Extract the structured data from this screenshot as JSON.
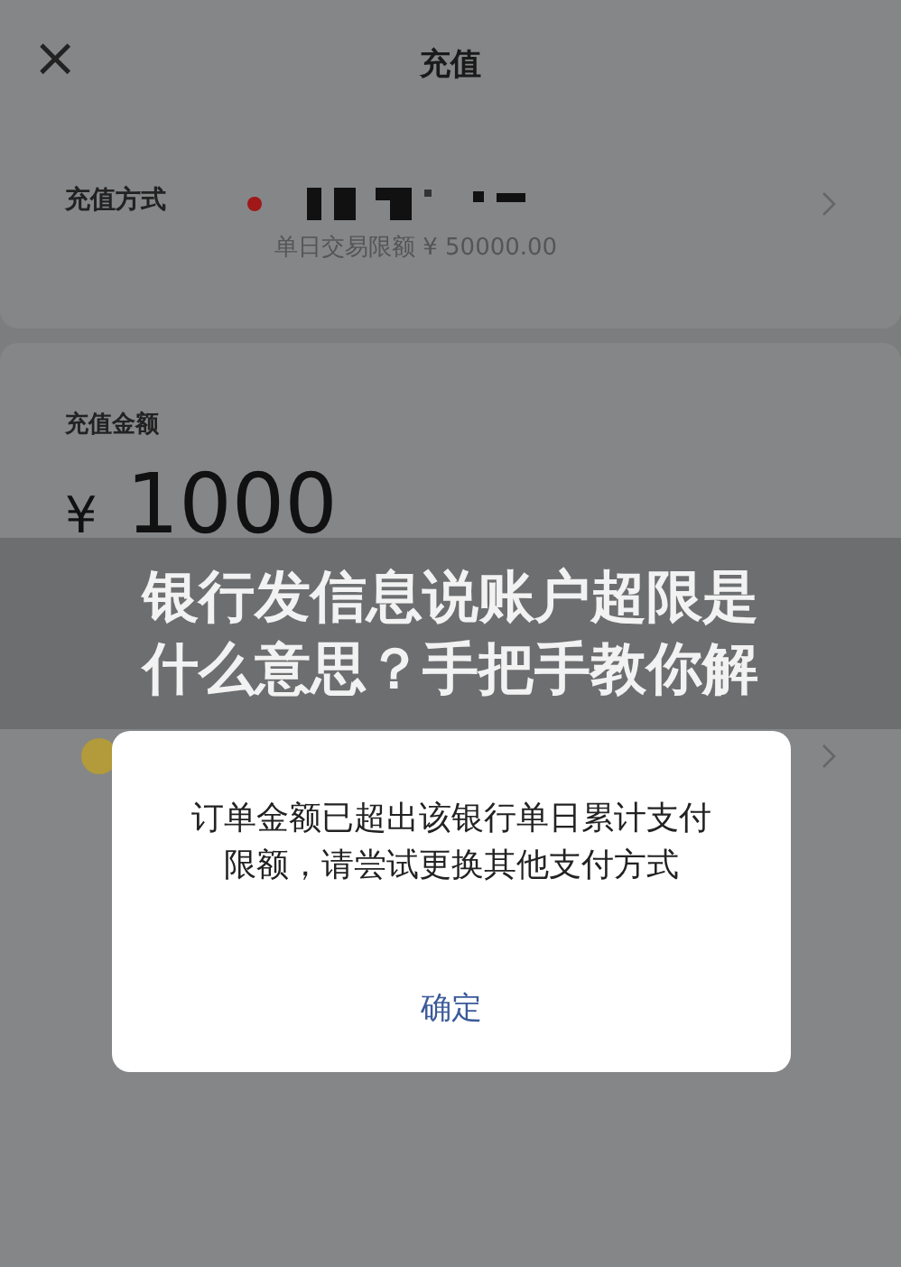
{
  "header": {
    "close_icon": "×",
    "title": "充值"
  },
  "payment_method": {
    "label": "充值方式",
    "limit": "单日交易限额 ¥ 50000.00"
  },
  "amount": {
    "label": "充值金额",
    "currency": "¥",
    "value": "1000"
  },
  "caption": "银行发信息说账户超限是什么意思？手把手教你解",
  "dialog": {
    "message": "订单金额已超出该银行单日累计支付限额，请尝试更换其他支付方式",
    "button": "确定"
  }
}
